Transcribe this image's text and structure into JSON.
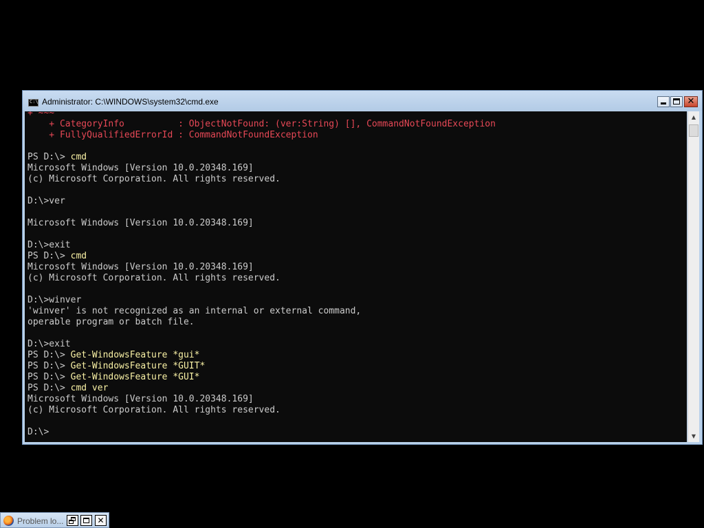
{
  "window": {
    "title": "Administrator: C:\\WINDOWS\\system32\\cmd.exe",
    "icon": "cmd-icon",
    "icon_text": "C:\\"
  },
  "controls": {
    "minimize_icon": "minimize-icon",
    "maximize_icon": "maximize-icon",
    "close_icon": "close-icon",
    "close_glyph": "✕"
  },
  "console": {
    "lines": [
      {
        "type": "error",
        "text": "+ ~~~"
      },
      {
        "type": "error",
        "text": "    + CategoryInfo          : ObjectNotFound: (ver:String) [], CommandNotFoundException"
      },
      {
        "type": "error",
        "text": "    + FullyQualifiedErrorId : CommandNotFoundException"
      },
      {
        "type": "blank",
        "text": ""
      },
      {
        "type": "ps",
        "prompt": "PS D:\\> ",
        "command": "cmd"
      },
      {
        "type": "output",
        "text": "Microsoft Windows [Version 10.0.20348.169]"
      },
      {
        "type": "output",
        "text": "(c) Microsoft Corporation. All rights reserved."
      },
      {
        "type": "blank",
        "text": ""
      },
      {
        "type": "output",
        "text": "D:\\>ver"
      },
      {
        "type": "blank",
        "text": ""
      },
      {
        "type": "output",
        "text": "Microsoft Windows [Version 10.0.20348.169]"
      },
      {
        "type": "blank",
        "text": ""
      },
      {
        "type": "output",
        "text": "D:\\>exit"
      },
      {
        "type": "ps",
        "prompt": "PS D:\\> ",
        "command": "cmd"
      },
      {
        "type": "output",
        "text": "Microsoft Windows [Version 10.0.20348.169]"
      },
      {
        "type": "output",
        "text": "(c) Microsoft Corporation. All rights reserved."
      },
      {
        "type": "blank",
        "text": ""
      },
      {
        "type": "output",
        "text": "D:\\>winver"
      },
      {
        "type": "output",
        "text": "'winver' is not recognized as an internal or external command,"
      },
      {
        "type": "output",
        "text": "operable program or batch file."
      },
      {
        "type": "blank",
        "text": ""
      },
      {
        "type": "output",
        "text": "D:\\>exit"
      },
      {
        "type": "ps",
        "prompt": "PS D:\\> ",
        "command": "Get-WindowsFeature *gui*"
      },
      {
        "type": "ps",
        "prompt": "PS D:\\> ",
        "command": "Get-WindowsFeature *GUIT*"
      },
      {
        "type": "ps",
        "prompt": "PS D:\\> ",
        "command": "Get-WindowsFeature *GUI*"
      },
      {
        "type": "ps",
        "prompt": "PS D:\\> ",
        "command": "cmd ver"
      },
      {
        "type": "output",
        "text": "Microsoft Windows [Version 10.0.20348.169]"
      },
      {
        "type": "output",
        "text": "(c) Microsoft Corporation. All rights reserved."
      },
      {
        "type": "blank",
        "text": ""
      },
      {
        "type": "output",
        "text": "D:\\>"
      }
    ]
  },
  "scrollbar": {
    "up_arrow": "▲",
    "down_arrow": "▼"
  },
  "minimized": {
    "title": "Problem lo...",
    "icon": "firefox-icon",
    "close_glyph": "✕"
  },
  "colors": {
    "console_bg": "#0c0c0c",
    "console_text": "#cccccc",
    "error_text": "#e74856",
    "command_text": "#f9f1a5",
    "titlebar": "#b9d1ea",
    "close_button": "#c7432a"
  }
}
